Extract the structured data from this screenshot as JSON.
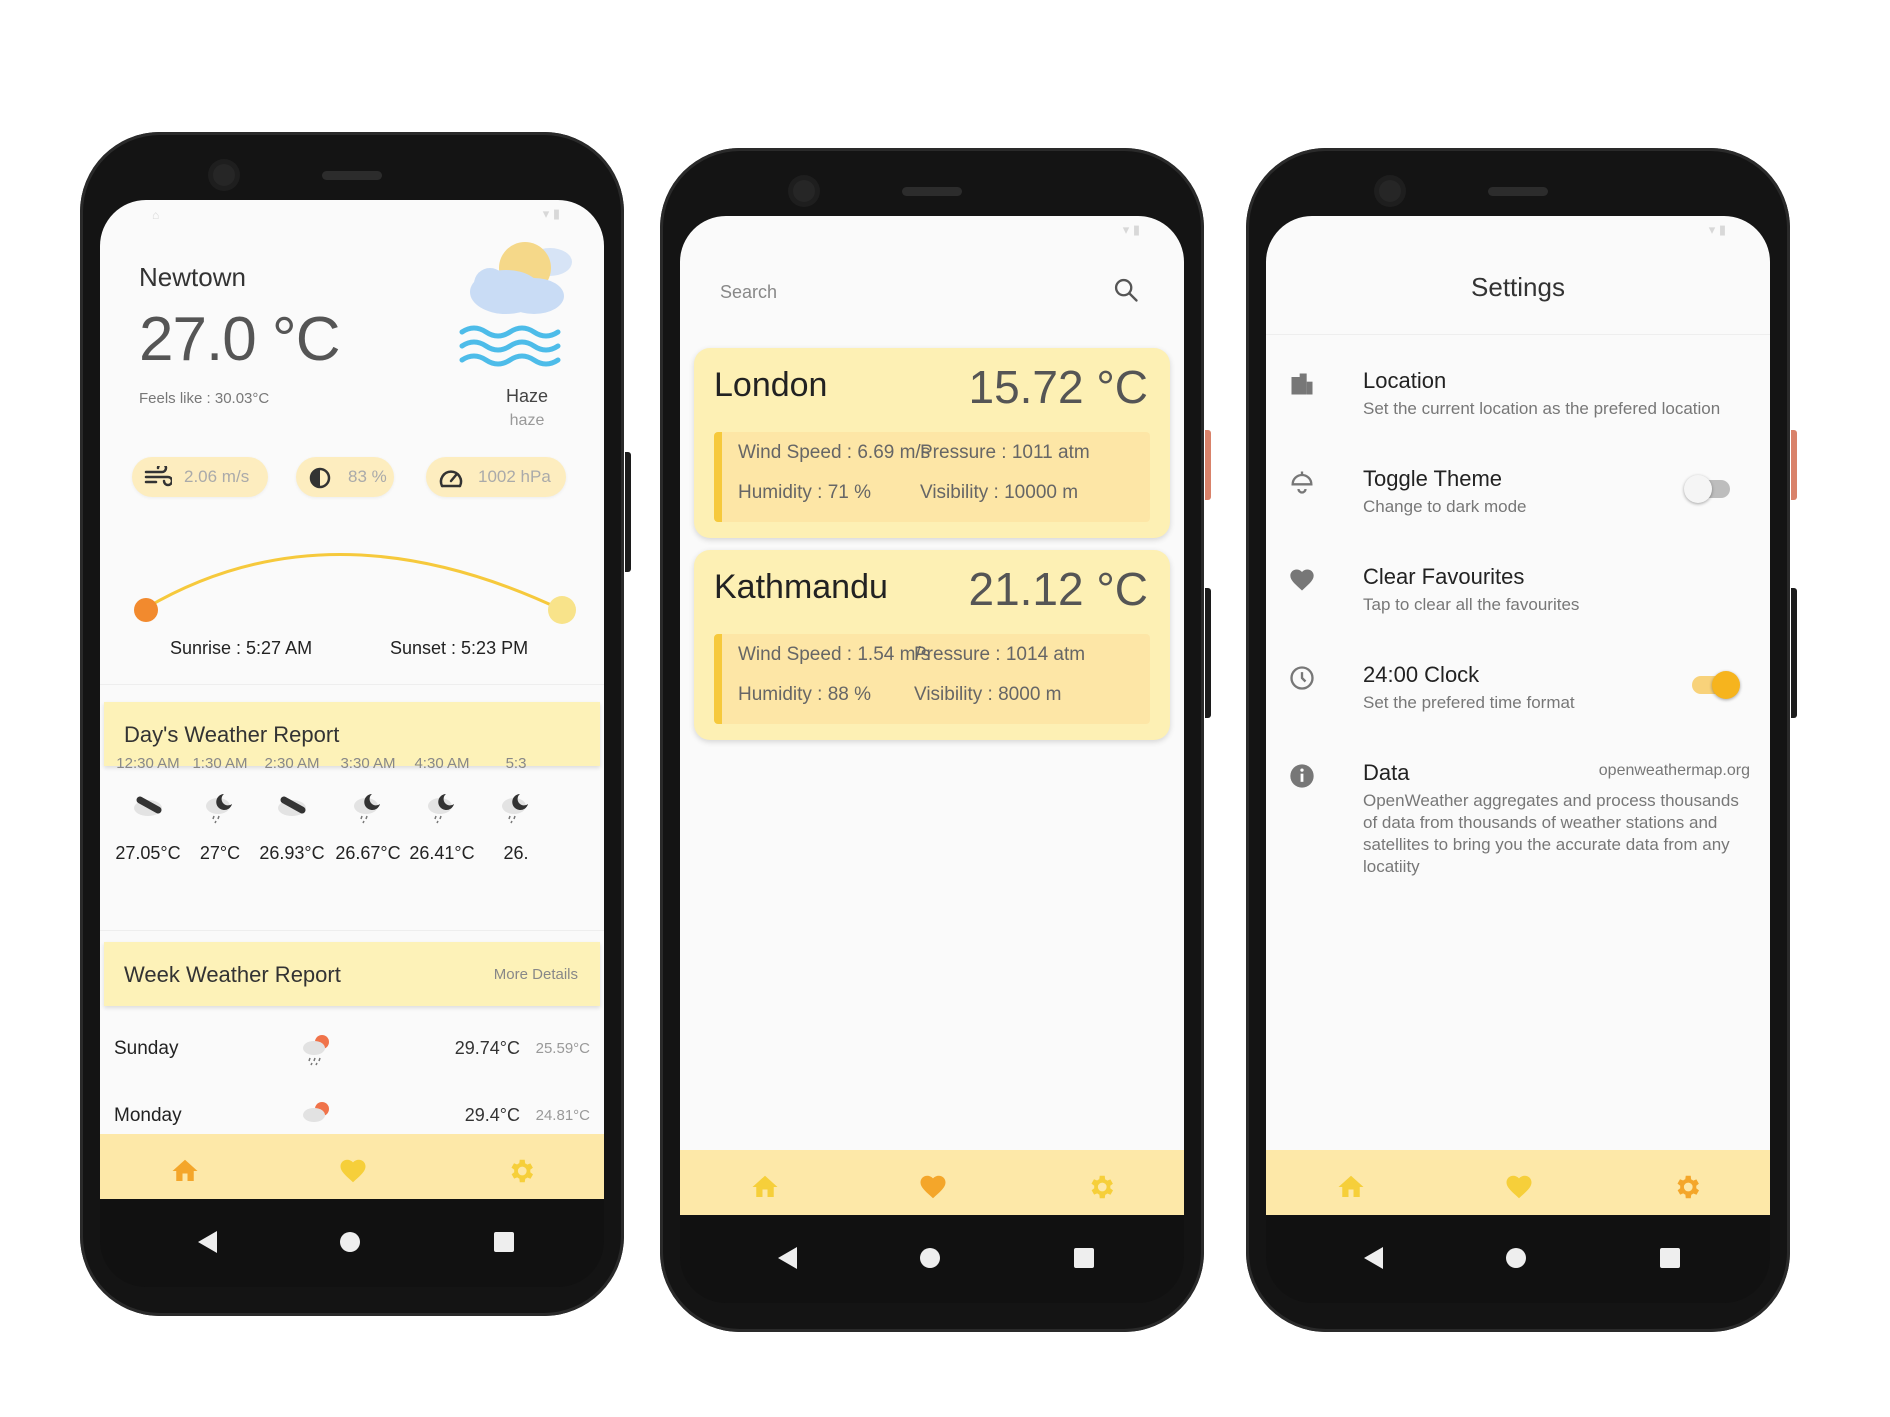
{
  "colors": {
    "accent": "#f6c93c",
    "card": "#fdf0b4",
    "bottom_bar": "#fde8a8",
    "nav_icon": "#f6b93b",
    "home_icon": "#f4a62a"
  },
  "home": {
    "city": "Newtown",
    "temperature": "27.0 °C",
    "feels_like": "Feels like : 30.03°C",
    "condition": "Haze",
    "condition_detail": "haze",
    "wind": "2.06 m/s",
    "humidity": "83 %",
    "pressure": "1002 hPa",
    "sunrise": "Sunrise : 5:27 AM",
    "sunset": "Sunset : 5:23 PM",
    "days_report_title": "Day's Weather Report",
    "hourly": [
      {
        "time": "12:30 AM",
        "temp": "27.05°C",
        "icon": "cloud-rain-icon"
      },
      {
        "time": "1:30 AM",
        "temp": "27°C",
        "icon": "night-rain-icon"
      },
      {
        "time": "2:30 AM",
        "temp": "26.93°C",
        "icon": "cloud-rain-icon"
      },
      {
        "time": "3:30 AM",
        "temp": "26.67°C",
        "icon": "night-rain-icon"
      },
      {
        "time": "4:30 AM",
        "temp": "26.41°C",
        "icon": "night-rain-icon"
      },
      {
        "time": "5:3",
        "temp": "26.",
        "icon": "night-rain-icon"
      }
    ],
    "week_report_title": "Week Weather Report",
    "more_details": "More Details",
    "weekly": [
      {
        "day": "Sunday",
        "high": "29.74°C",
        "low": "25.59°C",
        "icon": "sun-rain-icon"
      },
      {
        "day": "Monday",
        "high": "29.4°C",
        "low": "24.81°C",
        "icon": "sun-rain-icon"
      }
    ]
  },
  "favourites": {
    "search_placeholder": "Search",
    "cards": [
      {
        "city": "London",
        "temp": "15.72 °C",
        "wind": "Wind Speed : 6.69 m/s",
        "pressure": "Pressure : 1011 atm",
        "humidity": "Humidity : 71 %",
        "visibility": "Visibility : 10000 m"
      },
      {
        "city": "Kathmandu",
        "temp": "21.12 °C",
        "wind": "Wind Speed : 1.54 m/s",
        "pressure": "Pressure : 1014 atm",
        "humidity": "Humidity : 88 %",
        "visibility": "Visibility : 8000 m"
      }
    ]
  },
  "settings": {
    "title": "Settings",
    "items": [
      {
        "title": "Location",
        "desc": "Set the current location as the prefered location",
        "icon": "building-icon"
      },
      {
        "title": "Toggle Theme",
        "desc": "Change to dark mode",
        "icon": "lamp-icon",
        "toggle": false
      },
      {
        "title": "Clear Favourites",
        "desc": "Tap to clear all the favourites",
        "icon": "heart-icon"
      },
      {
        "title": "24:00 Clock",
        "desc": "Set the prefered time format",
        "icon": "clock-icon",
        "toggle": true
      },
      {
        "title": "Data",
        "desc": "OpenWeather aggregates and process thousands of data from thousands of weather stations and satellites to bring you the accurate data from any locatiity",
        "icon": "info-icon",
        "link": "openweathermap.org"
      }
    ]
  },
  "bottom_nav": [
    "home-icon",
    "heart-icon",
    "gear-icon"
  ]
}
